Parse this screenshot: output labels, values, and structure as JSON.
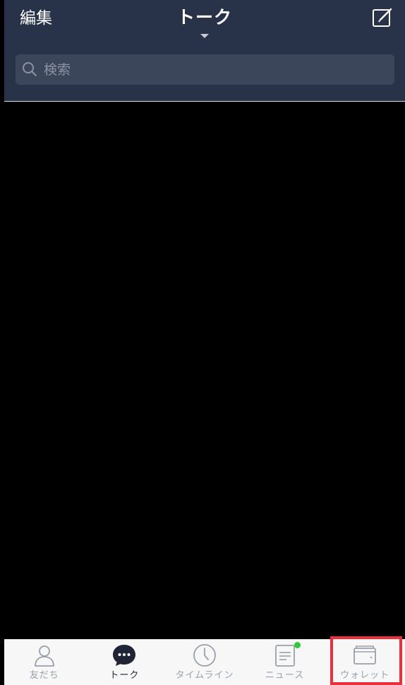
{
  "header": {
    "edit_label": "編集",
    "title": "トーク",
    "compose_icon": "compose-icon",
    "caret_icon": "caret-down-icon"
  },
  "search": {
    "placeholder": "検索",
    "value": "",
    "icon": "search-icon"
  },
  "tabs": [
    {
      "label": "友だち",
      "icon": "friends-icon",
      "active": false
    },
    {
      "label": "トーク",
      "icon": "chat-icon",
      "active": true
    },
    {
      "label": "タイムライン",
      "icon": "clock-icon",
      "active": false
    },
    {
      "label": "ニュース",
      "icon": "news-icon",
      "active": false,
      "badge": true
    },
    {
      "label": "ウォレット",
      "icon": "wallet-icon",
      "active": false
    }
  ],
  "colors": {
    "header_bg": "#283349",
    "search_bg": "#3c465a",
    "tabbar_bg": "#f7f7f8",
    "active_tab": "#1f2535",
    "inactive_tab": "#9aa0a8",
    "news_badge": "#2fcc39",
    "highlight": "#e8313d"
  }
}
